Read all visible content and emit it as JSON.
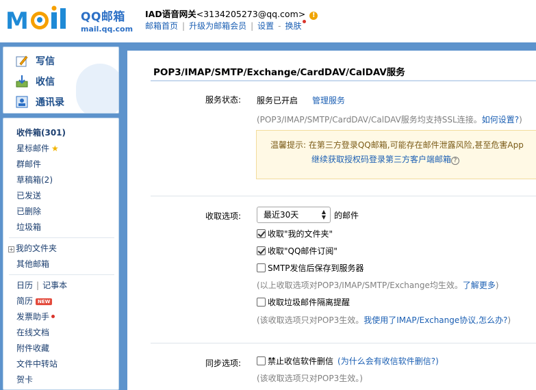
{
  "header": {
    "logo_text": "MOil",
    "logo_cn": "QQ邮箱",
    "logo_url": "mail.qq.com",
    "account_name": "IAD语音网关",
    "account_email": "<3134205273@qq.com>",
    "links": [
      "邮箱首页",
      "升级为邮箱会员",
      "设置",
      "换肤"
    ]
  },
  "sidebar": {
    "actions": [
      "写信",
      "收信",
      "通讯录"
    ],
    "folders": [
      "收件箱(301)",
      "星标邮件",
      "群邮件",
      "草稿箱(2)",
      "已发送",
      "已删除",
      "垃圾箱"
    ],
    "my_folders": "我的文件夹",
    "other_mail": "其他邮箱",
    "calendar": "日历",
    "notes": "记事本",
    "resume": "简历",
    "new_badge": "NEW",
    "invoice": "发票助手",
    "online_docs": "在线文档",
    "attachments": "附件收藏",
    "file_transfer": "文件中转站",
    "greeting": "贺卡"
  },
  "main": {
    "title": "POP3/IMAP/SMTP/Exchange/CardDAV/CalDAV服务",
    "status_label": "服务状态:",
    "status_value": "服务已开启",
    "manage_link": "管理服务",
    "ssl_note_prefix": "(POP3/IMAP/SMTP/CardDAV/CalDAV服务均支持SSL连接。",
    "ssl_note_link": "如何设置?",
    "ssl_note_suffix": ")",
    "notice_line1": "温馨提示: 在第三方登录QQ邮箱,可能存在邮件泄露风险,甚至危害App",
    "notice_line2": "继续获取授权码登录第三方客户端邮箱",
    "notice_qmark": "?",
    "receive_label": "收取选项:",
    "receive_select": "最近30天",
    "receive_suffix": "的邮件",
    "cb_my_folders": "收取\"我的文件夹\"",
    "cb_subscriptions": "收取\"QQ邮件订阅\"",
    "cb_smtp_save": "SMTP发信后保存到服务器",
    "receive_note_prefix": "(以上收取选项对POP3/IMAP/SMTP/Exchange均生效。",
    "receive_note_link": "了解更多",
    "receive_note_suffix": ")",
    "cb_spam_alert": "收取垃圾邮件隔离提醒",
    "pop3_note_prefix": "(该收取选项只对POP3生效。",
    "pop3_note_link": "我使用了IMAP/Exchange协议,怎么办?",
    "pop3_note_suffix": ")",
    "sync_label": "同步选项:",
    "cb_no_delete": "禁止收信软件删信",
    "no_delete_link": "(为什么会有收信软件删信?)",
    "sync_note": "(该收取选项只对POP3生效。)"
  },
  "colors": {
    "accent": "#1b5fb3",
    "frame": "#5d93cc",
    "notice_bg": "#fff9e5",
    "badge_red": "#e34b3d"
  }
}
